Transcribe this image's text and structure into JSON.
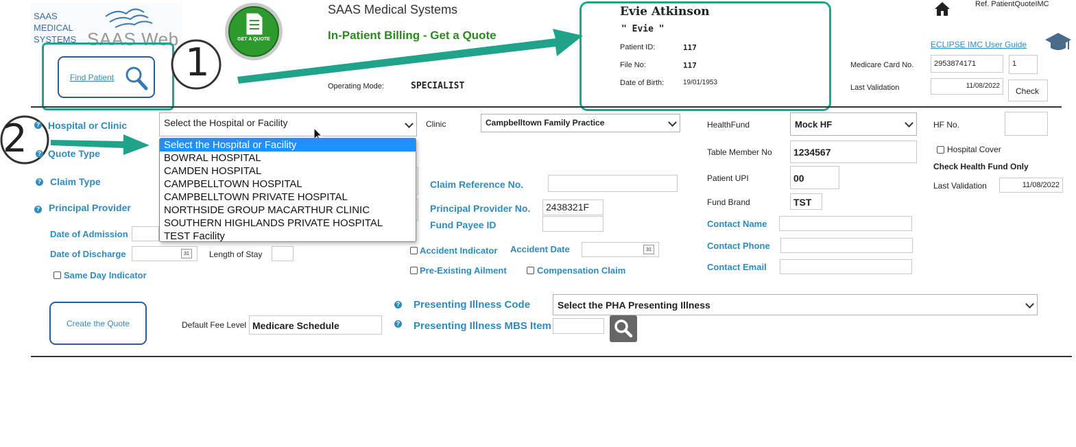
{
  "brand": {
    "logo_line1": "SAAS",
    "logo_line2": "MEDICAL",
    "logo_line3": "SYSTEMS",
    "logo_web": "SAAS Web",
    "quote_badge": "GET A QUOTE",
    "company": "SAAS Medical Systems",
    "page_title": "In-Patient Billing - Get a Quote"
  },
  "header": {
    "ref": "Ref. PatientQuoteIMC",
    "guide_link": "ECLIPSE IMC User Guide",
    "operating_mode_label": "Operating Mode:",
    "operating_mode_value": "SPECIALIST",
    "find_patient": "Find Patient"
  },
  "patient": {
    "name": "Evie Atkinson",
    "nickname": "\" Evie \"",
    "id_label": "Patient ID:",
    "id_value": "117",
    "file_label": "File No:",
    "file_value": "117",
    "dob_label": "Date of Birth:",
    "dob_value": "19/01/1953"
  },
  "medicare": {
    "card_label": "Medicare Card No.",
    "card_value": "2953874171",
    "irn_value": "1",
    "last_validation_label": "Last Validation",
    "last_validation_value": "11/08/2022",
    "check_button": "Check"
  },
  "annotations": {
    "step1": "1",
    "step2": "2"
  },
  "form": {
    "hospital_label": "Hospital or Clinic",
    "hospital_selected": "Select the Hospital or Facility",
    "hospital_options": [
      "Select the Hospital or Facility",
      "BOWRAL HOSPITAL",
      "CAMDEN HOSPITAL",
      "CAMPBELLTOWN HOSPITAL",
      "CAMPBELLTOWN PRIVATE HOSPITAL",
      "NORTHSIDE GROUP MACARTHUR CLINIC",
      "SOUTHERN HIGHLANDS PRIVATE HOSPITAL",
      "TEST Facility"
    ],
    "clinic_label": "Clinic",
    "clinic_value": "Campbelltown Family Practice",
    "quote_type_label": "Quote Type",
    "claim_type_label": "Claim Type",
    "principal_provider_label": "Principal Provider",
    "date_admission_label": "Date of Admission",
    "date_discharge_label": "Date of Discharge",
    "length_of_stay_label": "Length of Stay",
    "same_day_label": "Same Day Indicator",
    "claim_ref_label": "Claim Reference No.",
    "principal_provider_no_label": "Principal Provider No.",
    "principal_provider_no_value": "2438321F",
    "fund_payee_label": "Fund Payee ID",
    "accident_indicator_label": "Accident Indicator",
    "accident_date_label": "Accident Date",
    "pre_existing_label": "Pre-Existing Ailment",
    "compensation_label": "Compensation Claim",
    "create_quote_button": "Create the Quote",
    "default_fee_label": "Default Fee Level",
    "default_fee_value": "Medicare Schedule",
    "presenting_code_label": "Presenting Illness Code",
    "presenting_code_value": "Select the PHA Presenting Illness",
    "presenting_mbs_label": "Presenting Illness MBS Item",
    "calendar_glyph": "31"
  },
  "fund": {
    "healthfund_label": "HealthFund",
    "healthfund_value": "Mock HF",
    "hf_no_label": "HF No.",
    "table_member_label": "Table Member No",
    "table_member_value": "1234567",
    "hospital_cover_label": "Hospital Cover",
    "check_fund_only": "Check Health Fund Only",
    "patient_upi_label": "Patient UPI",
    "patient_upi_value": "00",
    "last_validation_label": "Last Validation",
    "last_validation_value": "11/08/2022",
    "fund_brand_label": "Fund Brand",
    "fund_brand_value": "TST",
    "contact_name_label": "Contact Name",
    "contact_phone_label": "Contact Phone",
    "contact_email_label": "Contact Email"
  },
  "colors": {
    "accent_blue": "#2e8bbd",
    "annotation_teal": "#1fa38a",
    "title_green": "#2a8a1e",
    "selected_option": "#1e90ff"
  }
}
